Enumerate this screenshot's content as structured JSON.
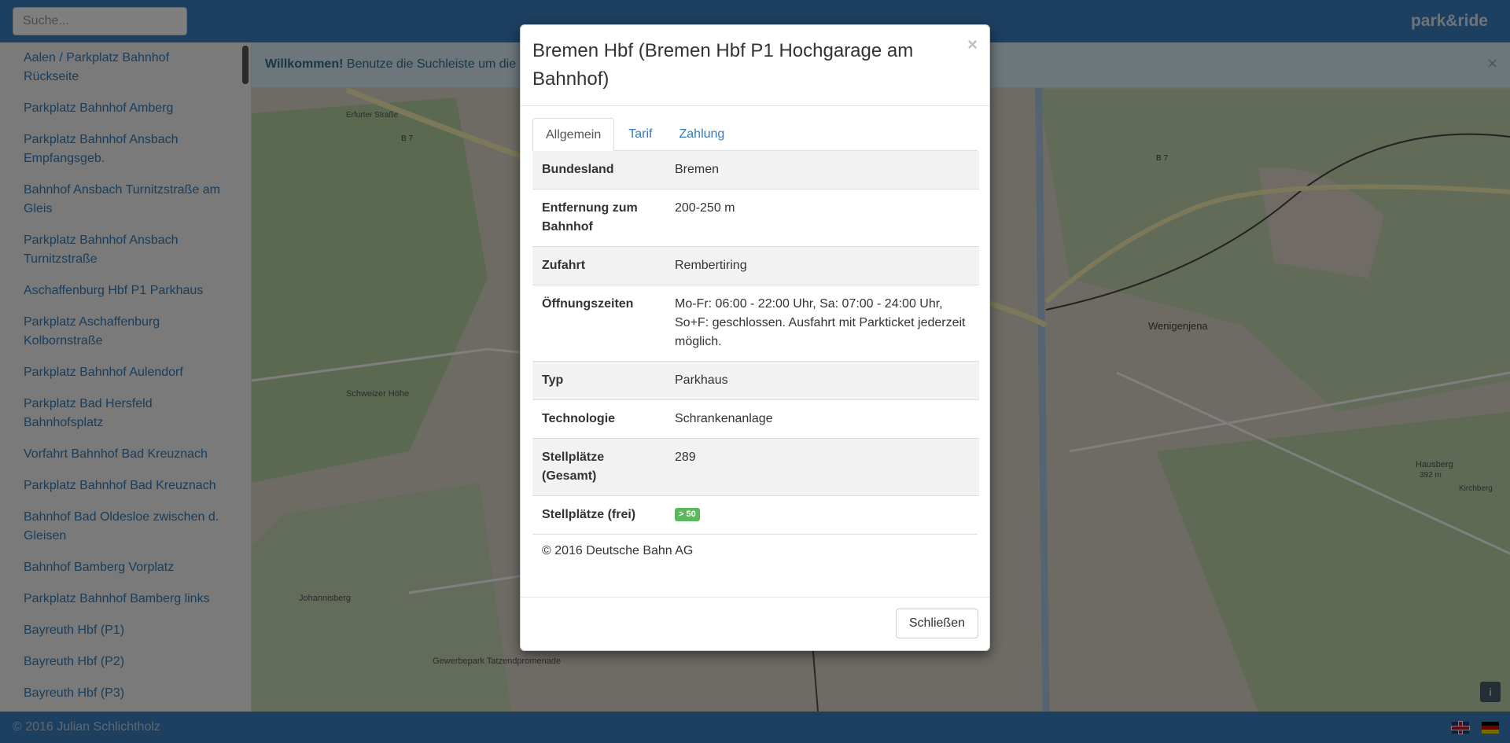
{
  "navbar": {
    "search_placeholder": "Suche...",
    "brand": "park&ride"
  },
  "sidebar": {
    "items": [
      "Aalen / Parkplatz Bahnhof Rückseite",
      "Parkplatz Bahnhof Amberg",
      "Parkplatz Bahnhof Ansbach Empfangsgeb.",
      "Bahnhof Ansbach Turnitzstraße am Gleis",
      "Parkplatz Bahnhof Ansbach Turnitzstraße",
      "Aschaffenburg Hbf P1 Parkhaus",
      "Parkplatz Aschaffenburg Kolbornstraße",
      "Parkplatz Bahnhof Aulendorf",
      "Parkplatz Bad Hersfeld Bahnhofsplatz",
      "Vorfahrt Bahnhof Bad Kreuznach",
      "Parkplatz Bahnhof Bad Kreuznach",
      "Bahnhof Bad Oldesloe zwischen d. Gleisen",
      "Bahnhof Bamberg Vorplatz",
      "Parkplatz Bahnhof Bamberg links",
      "Bayreuth Hbf (P1)",
      "Bayreuth Hbf (P2)",
      "Bayreuth Hbf (P3)"
    ]
  },
  "alert": {
    "strong": "Willkommen!",
    "text": " Benutze die Suchleiste um die",
    "close": "×"
  },
  "map": {
    "info_label": "i",
    "labels": {
      "schweizer_hoehe": "Schweizer Höhe",
      "wenigenjena": "Wenigenjena",
      "hausberg": "Hausberg",
      "hausberg_elev": "392 m",
      "gewerbepark": "Gewerbepark Tatzendpromenade",
      "johannisberg": "Johannisberg",
      "kirchberg": "Kirchberg",
      "b7_a": "B 7",
      "b7_b": "B 7",
      "erfurter": "Erfurter Straße"
    }
  },
  "footer": {
    "copyright": "© 2016 Julian Schlichtholz"
  },
  "modal": {
    "title": "Bremen Hbf (Bremen Hbf P1 Hochgarage am Bahnhof)",
    "close": "×",
    "tabs": [
      "Allgemein",
      "Tarif",
      "Zahlung"
    ],
    "rows": [
      {
        "key": "Bundesland",
        "value": "Bremen"
      },
      {
        "key": "Entfernung zum Bahnhof",
        "value": "200-250 m"
      },
      {
        "key": "Zufahrt",
        "value": "Rembertiring"
      },
      {
        "key": "Öffnungszeiten",
        "value": "Mo-Fr: 06:00 - 22:00 Uhr, Sa: 07:00 - 24:00 Uhr, So+F: geschlossen. Ausfahrt mit Parkticket jederzeit möglich."
      },
      {
        "key": "Typ",
        "value": "Parkhaus"
      },
      {
        "key": "Technologie",
        "value": "Schrankenanlage"
      },
      {
        "key": "Stellplätze (Gesamt)",
        "value": "289"
      },
      {
        "key": "Stellplätze (frei)",
        "badge": "> 50"
      }
    ],
    "copyright": "© 2016 Deutsche Bahn AG",
    "close_button": "Schließen"
  },
  "colors": {
    "navbar": "#3a7fc1",
    "link": "#337ab7",
    "badge_green": "#5cb85c",
    "alert_bg": "#d9edf7"
  },
  "icons": {
    "alert_close": "close-icon",
    "modal_close": "close-icon",
    "info": "info-icon",
    "flag_en": "flag-en-icon",
    "flag_de": "flag-de-icon"
  }
}
